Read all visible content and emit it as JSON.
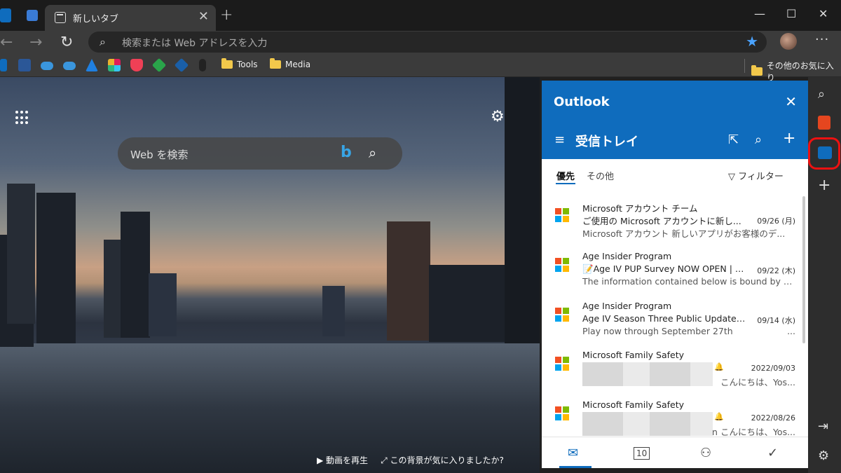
{
  "browser": {
    "tab_title": "新しいタブ",
    "tab_close": "✕",
    "new_tab_glyph": "+",
    "address_placeholder": "検索または Web アドレスを入力",
    "bookmarks": [
      {
        "label": "Tools"
      },
      {
        "label": "Media"
      }
    ],
    "other_favorites": "その他のお気に入り"
  },
  "new_tab_page": {
    "search_placeholder": "Web を検索",
    "play_video": "動画を再生",
    "like_background": "この背景が気に入りましたか?"
  },
  "outlook": {
    "app_title": "Outlook",
    "folder": "受信トレイ",
    "tabs": [
      {
        "label": "優先",
        "active": true
      },
      {
        "label": "その他",
        "active": false
      }
    ],
    "filter_label": "フィルター",
    "messages": [
      {
        "from": "Microsoft アカウント チーム",
        "subject": "ご使用の Microsoft アカウントに新し...",
        "date": "09/26 (月)",
        "preview": "Microsoft アカウント 新しいアプリがお客様のデ...",
        "redacted": false
      },
      {
        "from": "Age Insider Program",
        "subject": "📝Age IV PUP Survey NOW OPEN | Age...",
        "date": "09/22 (木)",
        "preview": "The information contained below is bound by the ...",
        "redacted": false
      },
      {
        "from": "Age Insider Program",
        "subject": "Age IV Season Three Public Update Pre...",
        "date": "09/14 (水)",
        "preview": "Play now through September 27th",
        "preview_tail": "...",
        "redacted": false
      },
      {
        "from": "Microsoft Family Safety",
        "date": "2022/09/03",
        "preview_tail": "こんにちは、Yos...",
        "redacted": true
      },
      {
        "from": "Microsoft Family Safety",
        "date": "2022/08/26",
        "preview_tail": "n こんにちは、Yos...",
        "redacted": true
      }
    ],
    "footer_calendar_day": "10"
  },
  "colors": {
    "outlook_blue": "#0f6cbd",
    "highlight_red": "#ee1111"
  }
}
